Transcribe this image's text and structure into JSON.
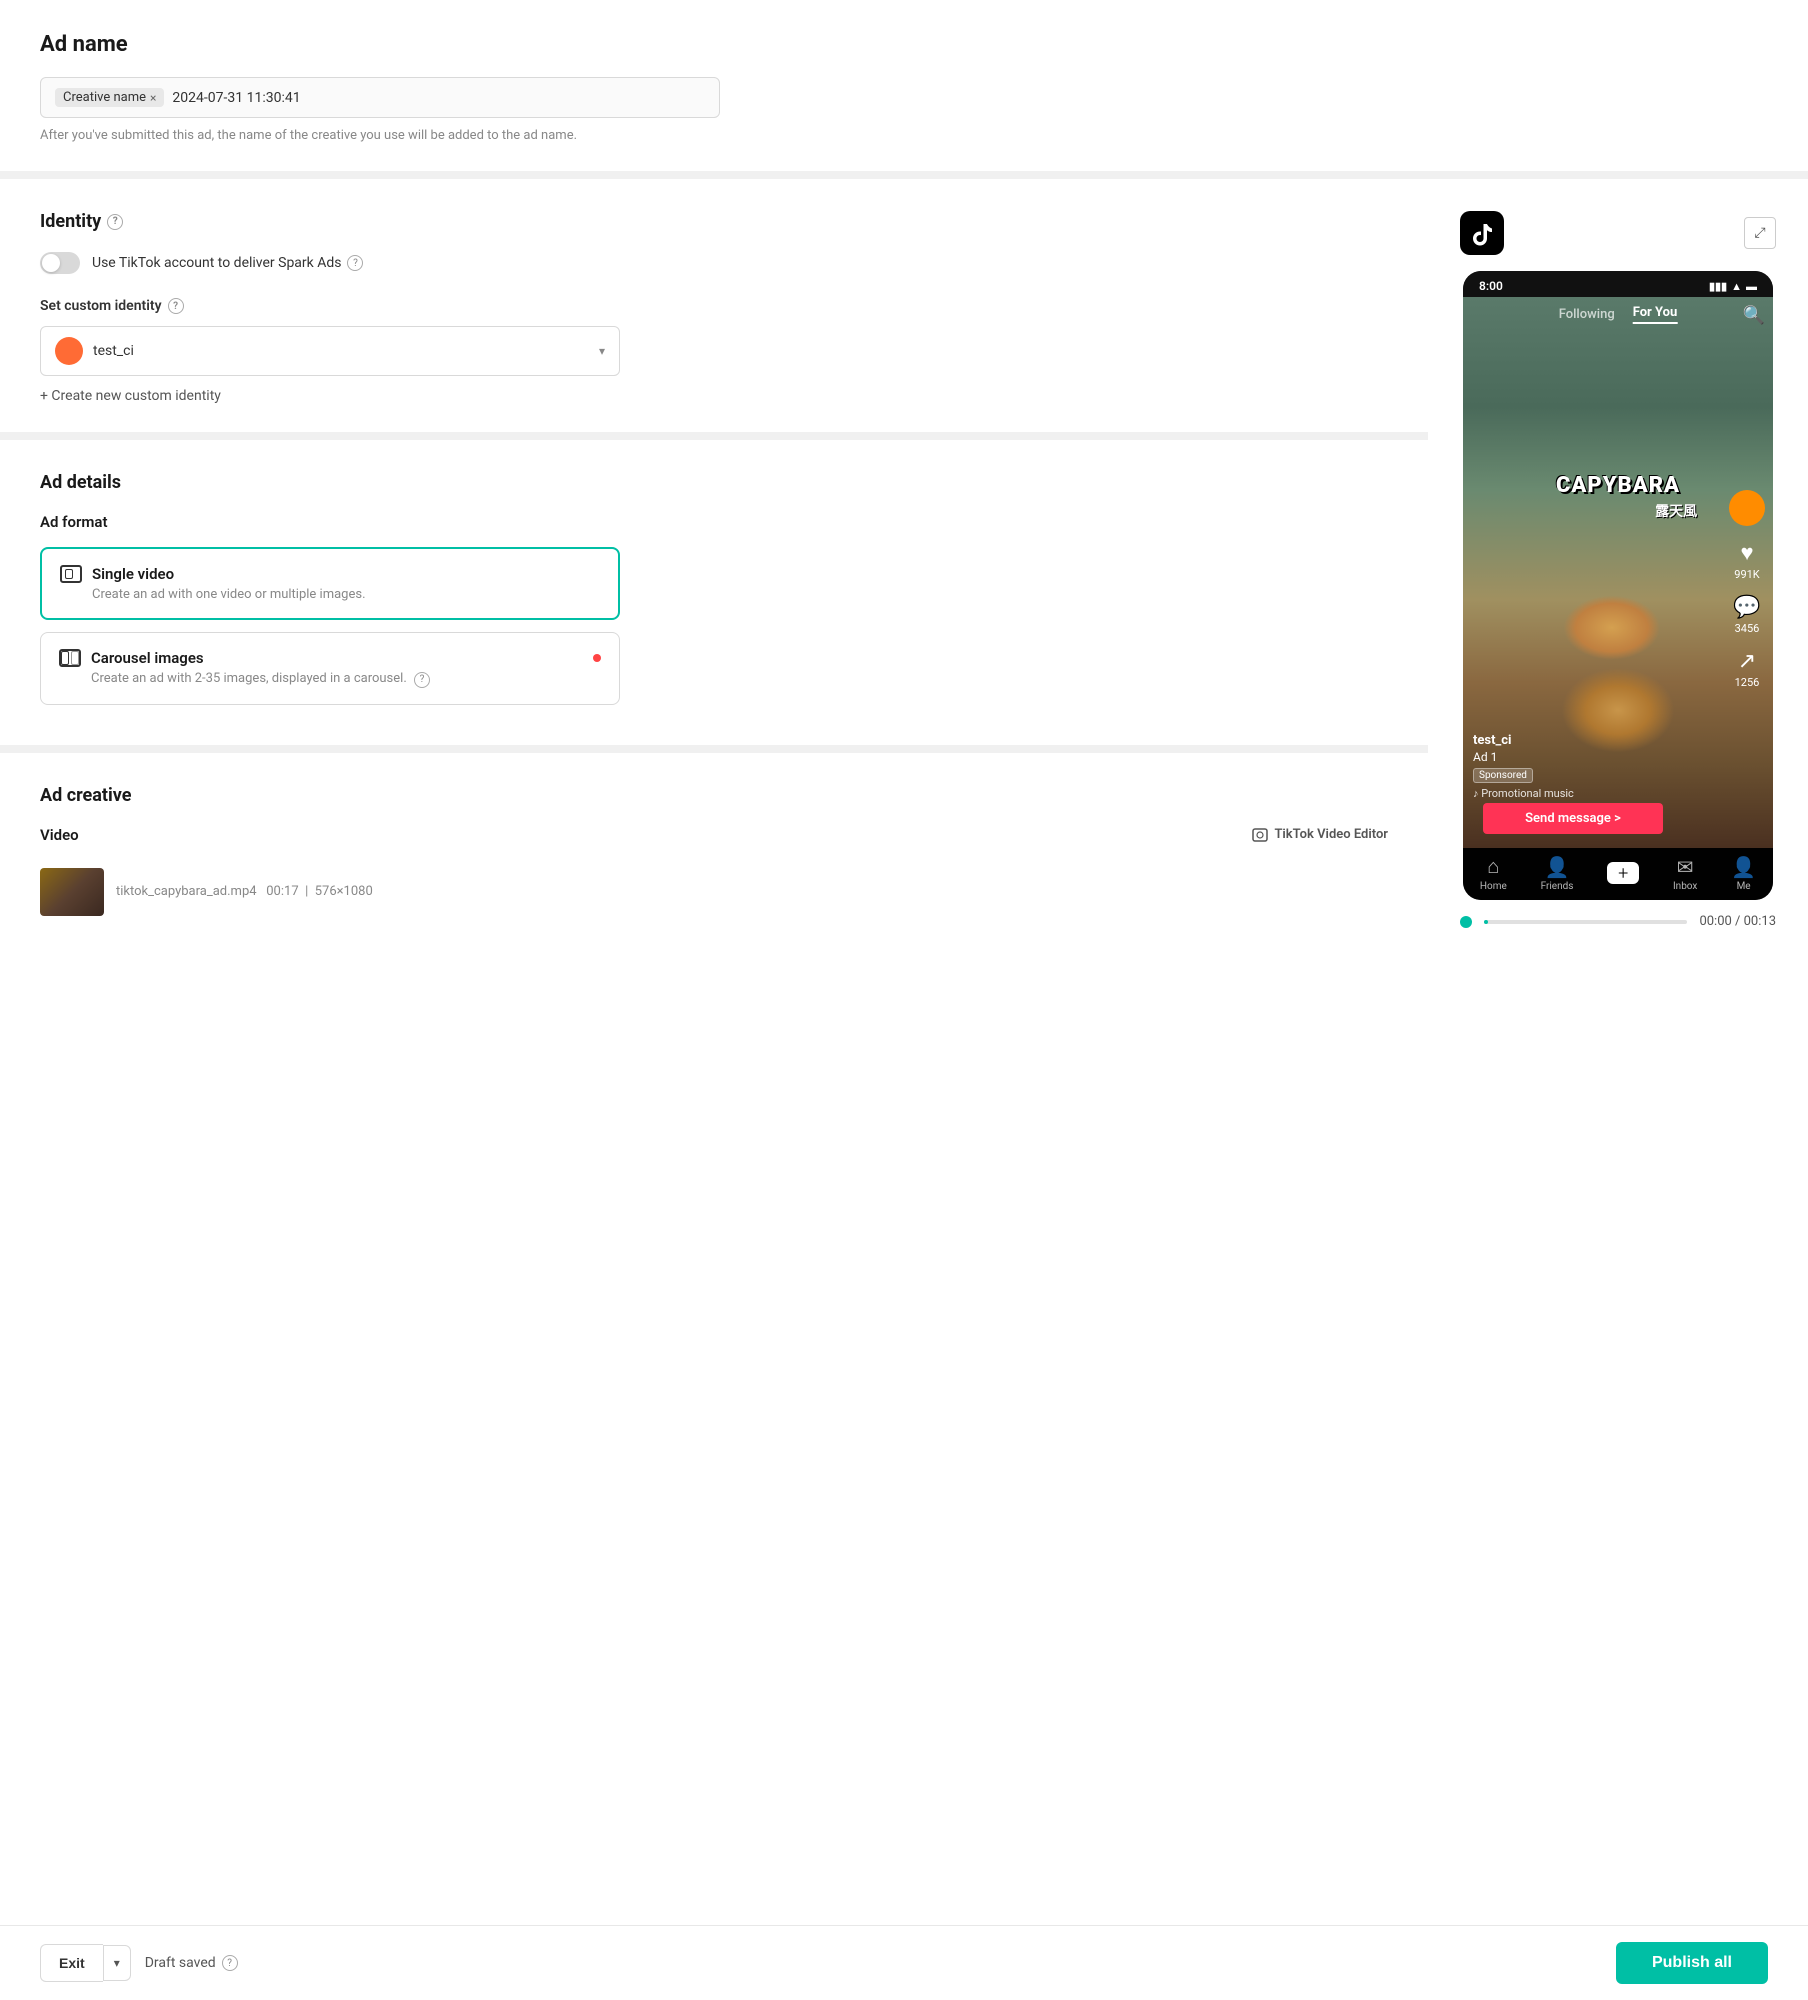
{
  "adName": {
    "sectionTitle": "Ad name",
    "tagLabel": "Creative name",
    "tagClose": "×",
    "nameValue": "2024-07-31 11:30:41",
    "hint": "After you've submitted this ad, the name of the creative you use will be added to the ad name."
  },
  "identity": {
    "sectionTitle": "Identity",
    "toggleLabel": "Use TikTok account to deliver Spark Ads",
    "customIdentityLabel": "Set custom identity",
    "selectedIdentity": "test_ci",
    "createNewLabel": "+ Create new custom identity",
    "helpTooltip": "?"
  },
  "adDetails": {
    "sectionTitle": "Ad details",
    "adFormatLabel": "Ad format",
    "formats": [
      {
        "name": "Single video",
        "description": "Create an ad with one video or multiple images.",
        "selected": true,
        "hasDot": false
      },
      {
        "name": "Carousel images",
        "description": "Create an ad with 2-35 images, displayed in a carousel.",
        "selected": false,
        "hasDot": true
      }
    ]
  },
  "adCreative": {
    "sectionTitle": "Ad creative",
    "videoLabel": "Video",
    "editorLinkLabel": "TikTok Video Editor",
    "videoFileName": "tiktok_capybara_ad.mp4",
    "videoDuration": "00:17",
    "videoSize": "576×1080"
  },
  "preview": {
    "tiktokLogoAlt": "TikTok",
    "statusTime": "8:00",
    "followingLabel": "Following",
    "forYouLabel": "For You",
    "capybaraText": "CAPYBARA",
    "capybaraTextSub": "露天風",
    "username": "test_ci",
    "adSubLabel": "Ad 1",
    "sponsoredLabel": "Sponsored",
    "musicLabel": "♪ Promotional music",
    "ctaLabel": "Send message >",
    "likeCount": "991K",
    "commentCount": "3456",
    "shareCount": "1256",
    "navItems": [
      "Home",
      "Friends",
      "",
      "Inbox",
      "Me"
    ],
    "progressTime": "00:00 / 00:13"
  },
  "bottomBar": {
    "exitLabel": "Exit",
    "draftLabel": "Draft saved",
    "publishLabel": "Publish all"
  }
}
